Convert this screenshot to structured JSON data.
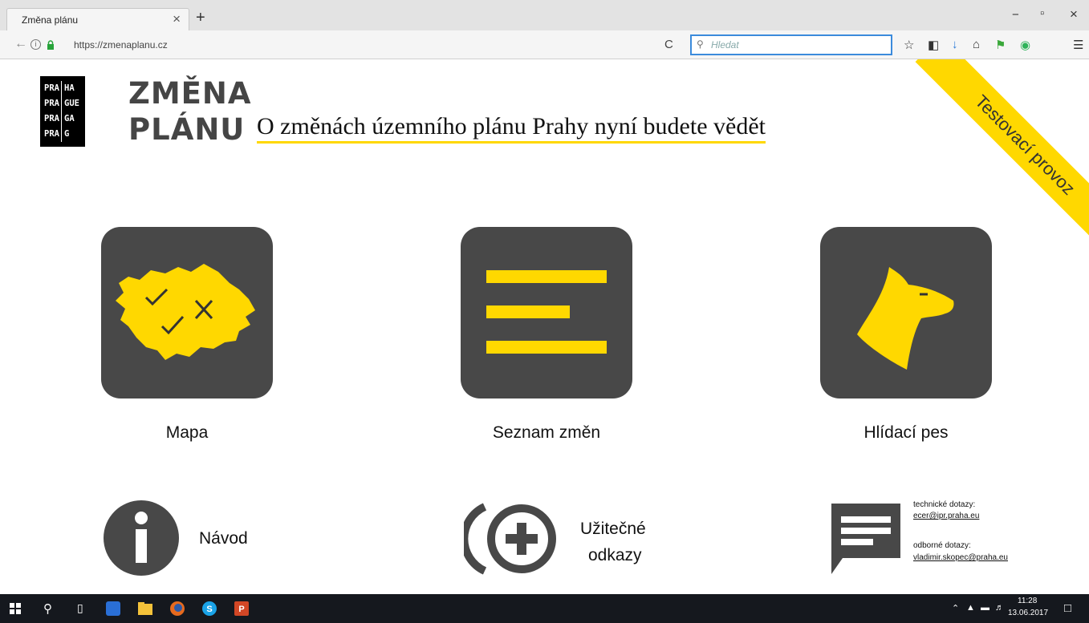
{
  "browser": {
    "tab_title": "Změna plánu",
    "tab_close": "×",
    "new_tab": "+",
    "window_minimize": "−",
    "window_restore": "▫",
    "window_close": "×",
    "url": "https://zmenaplanu.cz",
    "search_placeholder": "Hledat",
    "reload": "C"
  },
  "ribbon": {
    "text": "Testovací provoz",
    "color": "#ffd800"
  },
  "logo": {
    "rows": [
      [
        "PRA",
        "HA"
      ],
      [
        "PRA",
        "GUE"
      ],
      [
        "PRA",
        "GA"
      ],
      [
        "PRA",
        "G"
      ]
    ]
  },
  "header": {
    "brand_line1": "ZMĚNA",
    "brand_line2": "PLÁNU",
    "tagline": "O změnách územního plánu Prahy nyní budete vědět"
  },
  "tiles": [
    {
      "label": "Mapa",
      "icon": "prague-map-icon"
    },
    {
      "label": "Seznam změn",
      "icon": "list-icon"
    },
    {
      "label": "Hlídací pes",
      "icon": "watchdog-icon"
    }
  ],
  "bottom": {
    "guide": {
      "label": "Návod",
      "icon": "info-icon"
    },
    "links": {
      "label_line1": "Užitečné",
      "label_line2": "odkazy",
      "icon": "add-circle-icon"
    },
    "contact": {
      "icon": "chat-icon",
      "tech_label": "technické dotazy:",
      "tech_email": "ecer@ipr.praha.eu",
      "expert_label": "odborné dotazy:",
      "expert_email": "vladimir.skopec@praha.eu"
    }
  },
  "colors": {
    "accent": "#ffd800",
    "tile": "#484848",
    "text": "#111111"
  },
  "taskbar": {
    "time": "11:28",
    "date": "13.06.2017"
  }
}
